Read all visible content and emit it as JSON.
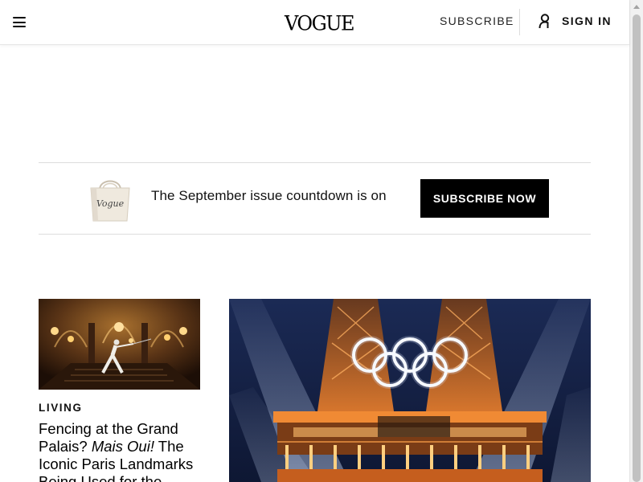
{
  "header": {
    "logo": "VOGUE",
    "subscribe_label": "SUBSCRIBE",
    "signin_label": "SIGN IN",
    "menu_icon": "hamburger-icon",
    "user_icon": "user-icon"
  },
  "promo": {
    "text": "The September issue countdown is on",
    "button_label": "SUBSCRIBE NOW",
    "image_icon": "vogue-tote-bag"
  },
  "stories": [
    {
      "rubric": "LIVING",
      "headline_part1": "Fencing at the Grand Palais? ",
      "headline_italic": "Mais Oui!",
      "headline_part2": " The Iconic Paris Landmarks Being Used for the",
      "image": "fencer in opera house"
    }
  ],
  "hero": {
    "image": "Eiffel Tower with Olympic rings lit at night"
  },
  "colors": {
    "accent": "#000000",
    "text": "#111111",
    "divider": "#dddddd"
  }
}
